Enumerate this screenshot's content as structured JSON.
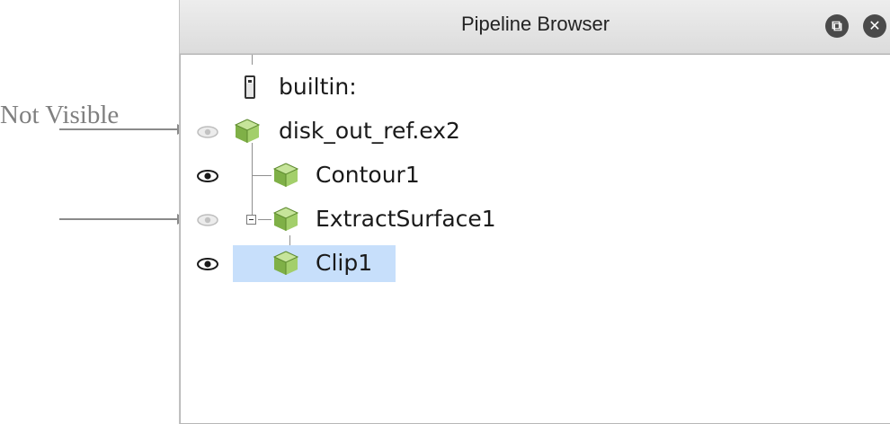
{
  "annotations": {
    "not_visible_label": "Not Visible"
  },
  "panel": {
    "title": "Pipeline Browser",
    "buttons": [
      {
        "name": "float",
        "glyph": "⧉"
      },
      {
        "name": "close",
        "glyph": "✕"
      }
    ]
  },
  "pipeline": {
    "items": [
      {
        "label": "builtin:",
        "icon": "server-icon",
        "visibility": "none"
      },
      {
        "label": "disk_out_ref.ex2",
        "icon": "cube-icon",
        "visibility": "hidden"
      },
      {
        "label": "Contour1",
        "icon": "cube-icon",
        "visibility": "visible"
      },
      {
        "label": "ExtractSurface1",
        "icon": "cube-icon",
        "visibility": "hidden",
        "expanded": true
      },
      {
        "label": "Clip1",
        "icon": "cube-icon",
        "visibility": "visible",
        "selected": true
      }
    ]
  },
  "colors": {
    "selection": "#c7dffb",
    "cube_green": "#8fc255",
    "annotation_gray": "#7f7f7f"
  }
}
